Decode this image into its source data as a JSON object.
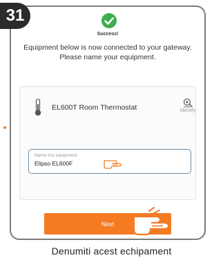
{
  "step": {
    "number": "31"
  },
  "success": {
    "title": "Success!"
  },
  "message": {
    "line1": "Equipment below is now connected to your gateway.",
    "line2": "Please name your equipment."
  },
  "device": {
    "name": "EL600T Room Thermostat",
    "icon": "thermometer-icon"
  },
  "identify": {
    "label": "Identify",
    "icon": "identify-icon"
  },
  "name_field": {
    "label": "Name this equipment",
    "value": "Elipso EL600F"
  },
  "next_button": {
    "label": "Next"
  },
  "caption": {
    "text": "Denumiti acest echipament"
  },
  "colors": {
    "accent": "#f47b22",
    "success": "#3cae4d",
    "badge": "#2b2b2b"
  }
}
